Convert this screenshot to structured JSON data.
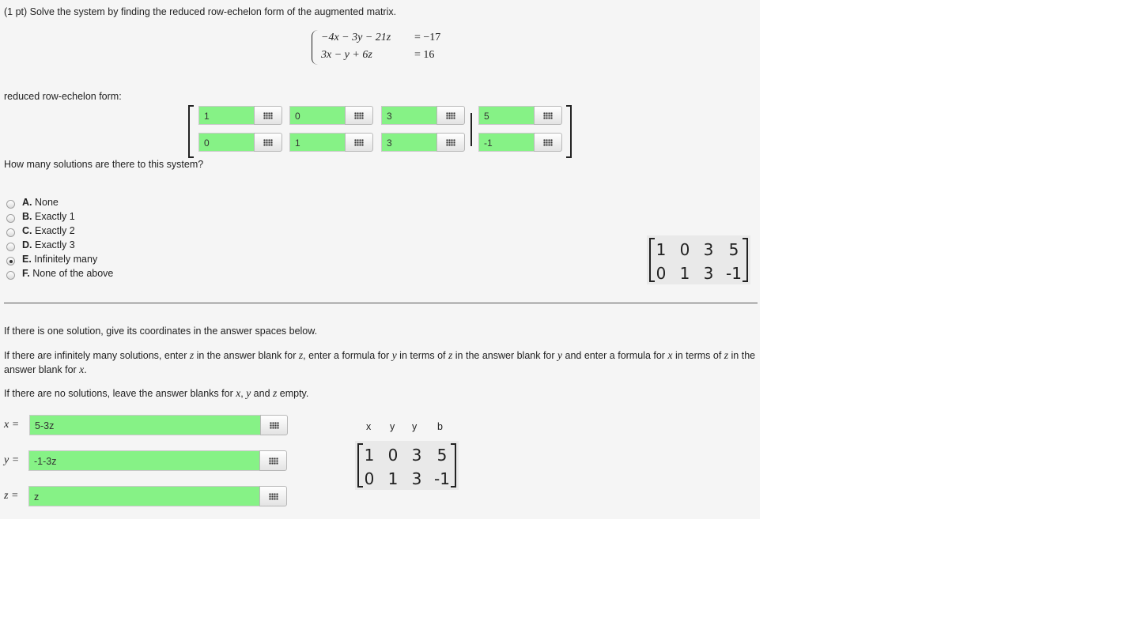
{
  "problem": {
    "header": "(1 pt) Solve the system by finding the reduced row-echelon form of the augmented matrix.",
    "equations": [
      {
        "lhs": "−4x − 3y − 21z",
        "rhs": "= −17"
      },
      {
        "lhs": "3x − y + 6z",
        "rhs": "= 16"
      }
    ]
  },
  "rref": {
    "label": "reduced row-echelon form:",
    "rows": [
      [
        "1",
        "0",
        "3",
        "5"
      ],
      [
        "0",
        "1",
        "3",
        "-1"
      ]
    ]
  },
  "question": {
    "text": "How many solutions are there to this system?",
    "options": [
      {
        "letter": "A.",
        "text": "None",
        "selected": false
      },
      {
        "letter": "B.",
        "text": "Exactly 1",
        "selected": false
      },
      {
        "letter": "C.",
        "text": "Exactly 2",
        "selected": false
      },
      {
        "letter": "D.",
        "text": "Exactly 3",
        "selected": false
      },
      {
        "letter": "E.",
        "text": "Infinitely many",
        "selected": true
      },
      {
        "letter": "F.",
        "text": "None of the above",
        "selected": false
      }
    ]
  },
  "preview_matrix_1": {
    "rows": [
      [
        "1",
        "0",
        "3",
        "5"
      ],
      [
        "0",
        "1",
        "3",
        "-1"
      ]
    ]
  },
  "instructions": {
    "one": "If there is one solution, give its coordinates in the answer spaces below.",
    "inf_1": "If there are infinitely many solutions, enter",
    "inf_2": "in the answer blank for",
    "inf_3": ", enter a formula for",
    "inf_4": "in terms of",
    "inf_5": "in the answer blank for",
    "inf_6": "and enter a formula for",
    "inf_7": "in terms of",
    "inf_8": "in the answer blank for",
    "none_1": "If there are no solutions, leave the answer blanks for",
    "none_2": "and",
    "none_3": "empty."
  },
  "answers": {
    "x": {
      "label": "x =",
      "value": "5-3z"
    },
    "y": {
      "label": "y =",
      "value": "-1-3z"
    },
    "z": {
      "label": "z =",
      "value": "z"
    }
  },
  "preview_matrix_2": {
    "headers": [
      "x",
      "y",
      "y",
      "b"
    ],
    "rows": [
      [
        "1",
        "0",
        "3",
        "5"
      ],
      [
        "0",
        "1",
        "3",
        "-1"
      ]
    ]
  },
  "colors": {
    "correct_field": "#86f286",
    "panel_bg": "#f5f5f5"
  },
  "icons": {
    "palette": "grid-icon"
  }
}
